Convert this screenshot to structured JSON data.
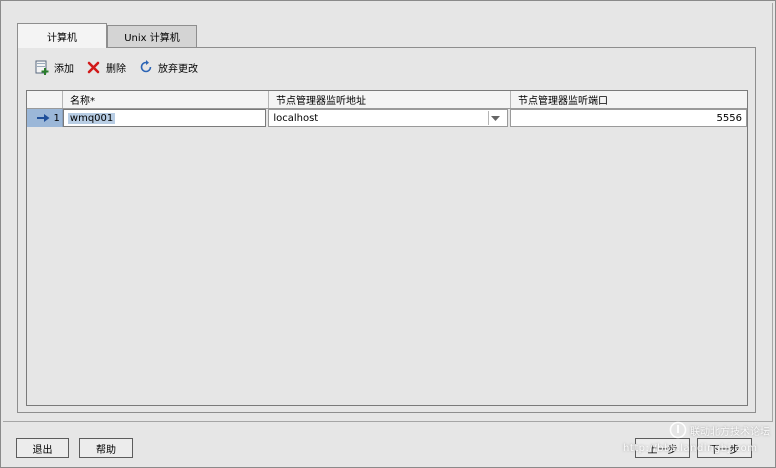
{
  "tabs": [
    {
      "label": "计算机",
      "active": true
    },
    {
      "label": "Unix 计算机",
      "active": false
    }
  ],
  "toolbar": {
    "add_label": "添加",
    "delete_label": "删除",
    "discard_label": "放弃更改"
  },
  "grid": {
    "columns": [
      "名称*",
      "节点管理器监听地址",
      "节点管理器监听端口"
    ],
    "rows": [
      {
        "index": "1",
        "name": "wmq001",
        "address": "localhost",
        "port": "5556"
      }
    ]
  },
  "footer": {
    "exit_label": "退出",
    "help_label": "帮助",
    "prev_label": "上一步",
    "next_label": "下一步"
  },
  "watermark": {
    "line1": "联动北方技术论坛",
    "line2": "http://bbs.landingbj.com"
  },
  "colors": {
    "selection_row_header": "#9bb7d8",
    "delete_icon": "#d11a1a",
    "add_icon": "#2a7d2a",
    "discard_icon": "#2b64b5"
  }
}
